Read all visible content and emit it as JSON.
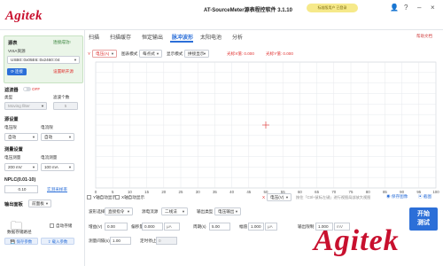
{
  "app": {
    "logo": "Agitek",
    "title": "AT-SourceMeter源表程控软件 3.1.10",
    "notice": "标准版用户 已登录",
    "brand_watermark": "Agitek"
  },
  "tabs": [
    {
      "label": "扫描"
    },
    {
      "label": "扫描缓存"
    },
    {
      "label": "恒定输出"
    },
    {
      "label": "脉冲波形"
    },
    {
      "label": "太阳电池"
    },
    {
      "label": "分析"
    }
  ],
  "help_link": "帮助文档",
  "sidebar": {
    "device_label": "源表",
    "connect_status": "连接成功!",
    "visa_label": "VISA资源",
    "visa_value": "USB0::0x05E6::0x2460::04",
    "connect_btn": "连接",
    "disconnect_btn": "设置断开源",
    "filter_label": "滤波器",
    "filter_toggle": "OFF",
    "filter_type_label": "类型",
    "filter_count_label": "滤波个数",
    "filter_type_value": "Moving filter",
    "filter_count_value": "5",
    "source_label": "源设置",
    "v_limit_label": "电压限",
    "i_limit_label": "电流限",
    "v_limit_value": "自动",
    "i_limit_value": "自动",
    "measure_label": "测量设置",
    "v_range_label": "电压测量",
    "i_range_label": "电流测量",
    "v_range_value": "200 mV",
    "i_range_value": "100 mA",
    "nplc_label": "NPLC(0.01-10)",
    "nplc_value": "0.10",
    "sample_rate_link": "实测采样率",
    "output_panel_label": "输出面板",
    "output_panel_value": "前面板",
    "data_save_label": "数据存储路径",
    "auto_save_label": "自动存储",
    "save_params_btn": "保存参数",
    "load_params_btn": "载入参数"
  },
  "plot_bar": {
    "y_label": "Y",
    "y_axis_select": "电压(A)",
    "display_mode_label": "图表模式",
    "display_mode_value": "每点式",
    "show_mode_label": "显示模式",
    "show_mode_value": "拼接显示",
    "cursor_x": "光标X值: 0.000",
    "cursor_y": "光标Y值: 0.000"
  },
  "chart_data": {
    "type": "line",
    "series": [],
    "x_ticks": [
      "0",
      "5",
      "10",
      "15",
      "20",
      "25",
      "30",
      "35",
      "40",
      "45",
      "50",
      "55",
      "60",
      "65",
      "70",
      "75",
      "80",
      "85",
      "90",
      "95",
      "100"
    ],
    "xlim": [
      0,
      100
    ],
    "y_ticks": [],
    "grid": true,
    "x_axis_select": "电压(V)",
    "x_label": "X"
  },
  "below_chart": {
    "y_auto_label": "Y轴自动显示",
    "x_auto_label": "X轴自动显示",
    "hint": "按住「Ctrl+鼠标左键」进行视图局部放大视图",
    "save_img": "保存图像",
    "clear": "截图"
  },
  "params_row1": {
    "waveform_label": "波形选择",
    "waveform_value": "直接指令",
    "scan_mode_label": "源电流源",
    "scan_mode_value": "二线法",
    "output_type_label": "输出类型",
    "output_type_value": "电压输出"
  },
  "params_row2": {
    "offset_label": "增益(V)",
    "offset_value": "0.00",
    "amplitude_label": "偏移量",
    "amplitude_value": "0.000",
    "amplitude_unit": "μA",
    "period_label": "周期(s)",
    "period_value": "5.00",
    "duty_label": "幅值",
    "duty_value": "1.000",
    "duty_unit": "μA",
    "limit_label": "输出限制",
    "limit_value": "1.000",
    "limit_unit": "mV"
  },
  "params_row3": {
    "points_label": "测量间隔(s)",
    "points_value": "1.00",
    "stop_label": "定时停止",
    "stop_value": "0"
  },
  "start_button": "开始\n测试"
}
